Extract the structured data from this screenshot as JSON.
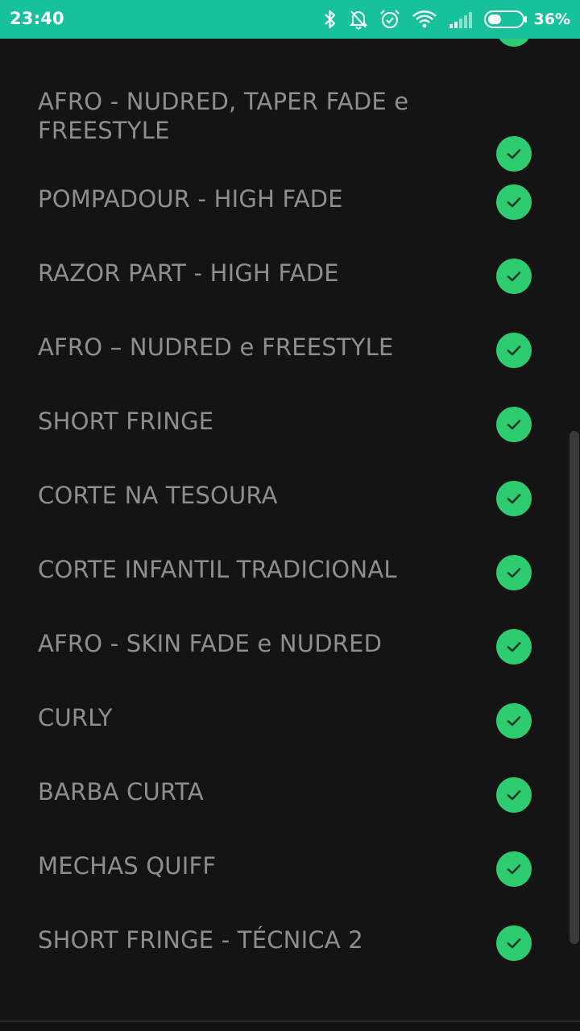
{
  "status_bar": {
    "time": "23:40",
    "battery_percent": "36%",
    "icons": [
      "bluetooth-icon",
      "notifications-off-icon",
      "alarm-icon",
      "wifi-icon",
      "signal-icon",
      "battery-icon"
    ],
    "background_color": "#17c19c"
  },
  "services": {
    "items": [
      {
        "label": "AFRO - NUDRED, TAPER FADE e FREESTYLE",
        "checked": true
      },
      {
        "label": "POMPADOUR - HIGH FADE",
        "checked": true
      },
      {
        "label": "RAZOR PART - HIGH FADE",
        "checked": true
      },
      {
        "label": "AFRO – NUDRED e FREESTYLE",
        "checked": true
      },
      {
        "label": "SHORT FRINGE",
        "checked": true
      },
      {
        "label": "CORTE NA TESOURA",
        "checked": true
      },
      {
        "label": "CORTE INFANTIL TRADICIONAL",
        "checked": true
      },
      {
        "label": "AFRO - SKIN FADE e NUDRED",
        "checked": true
      },
      {
        "label": "CURLY",
        "checked": true
      },
      {
        "label": "BARBA CURTA",
        "checked": true
      },
      {
        "label": "MECHAS QUIFF",
        "checked": true
      },
      {
        "label": "SHORT FRINGE - TÉCNICA 2",
        "checked": true
      }
    ],
    "check_color": "#2ecc71",
    "label_color": "#8e8e8e"
  }
}
